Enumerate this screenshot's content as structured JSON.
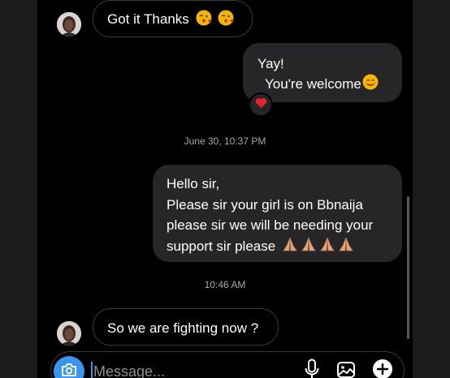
{
  "thread": {
    "messages": [
      {
        "direction": "incoming",
        "text": "Got it Thanks",
        "emoji": [
          "kissing-heart-emoji",
          "kissing-heart-emoji"
        ]
      },
      {
        "direction": "outgoing",
        "lines": [
          "Yay!",
          "You're welcome"
        ],
        "emoji": [
          "smiling-emoji"
        ],
        "reaction": "red-heart-emoji"
      },
      {
        "direction": "outgoing",
        "lines": [
          "Hello sir,",
          "Please sir your girl is on Bbnaija",
          "please sir we will be needing your",
          "support sir please"
        ],
        "emoji": [
          "folded-hands-emoji",
          "folded-hands-emoji",
          "folded-hands-emoji",
          "folded-hands-emoji"
        ]
      },
      {
        "direction": "incoming",
        "text": "So we are fighting now ?"
      }
    ],
    "timestamps": [
      "June 30, 10:37 PM",
      "10:46 AM"
    ]
  },
  "composer": {
    "placeholder": "Message...",
    "value": "",
    "icons": [
      "camera-icon",
      "microphone-icon",
      "gallery-icon",
      "plus-icon"
    ]
  },
  "colors": {
    "background": "#000000",
    "outgoing_bubble": "#262628",
    "incoming_border": "#3a3a3c",
    "accent": "#3797f0",
    "timestamp": "#a8a8a8"
  }
}
